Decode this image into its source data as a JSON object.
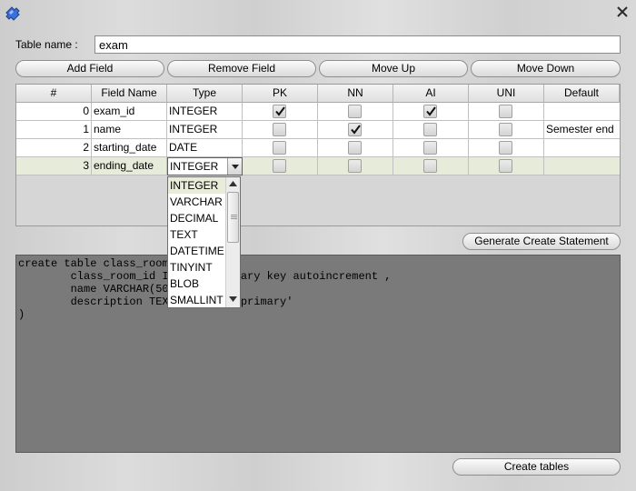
{
  "window": {
    "app_icon": "puzzle-app-icon",
    "close_icon": "close-icon"
  },
  "table_name": {
    "label": "Table name :",
    "value": "exam"
  },
  "toolbar": {
    "add_field": "Add Field",
    "remove_field": "Remove Field",
    "move_up": "Move Up",
    "move_down": "Move Down"
  },
  "grid": {
    "headers": [
      "#",
      "Field Name",
      "Type",
      "PK",
      "NN",
      "AI",
      "UNI",
      "Default"
    ],
    "rows": [
      {
        "index": "0",
        "name": "exam_id",
        "type": "INTEGER",
        "pk": true,
        "nn": false,
        "ai": true,
        "uni": false,
        "default": ""
      },
      {
        "index": "1",
        "name": "name",
        "type": "INTEGER",
        "pk": false,
        "nn": true,
        "ai": false,
        "uni": false,
        "default": "Semester end"
      },
      {
        "index": "2",
        "name": "starting_date",
        "type": "DATE",
        "pk": false,
        "nn": false,
        "ai": false,
        "uni": false,
        "default": ""
      },
      {
        "index": "3",
        "name": "ending_date",
        "type": "INTEGER",
        "pk": false,
        "nn": false,
        "ai": false,
        "uni": false,
        "default": ""
      }
    ],
    "selected_row": 3
  },
  "type_dropdown": {
    "options": [
      "INTEGER",
      "VARCHAR",
      "DECIMAL",
      "TEXT",
      "DATETIME",
      "TINYINT",
      "BLOB",
      "SMALLINT"
    ],
    "selected": "INTEGER"
  },
  "generate_button": "Generate Create Statement",
  "sql_output": "create table class_room(\n        class_room_id INTEGER primary key autoincrement ,\n        name VARCHAR(50) ,\n        description TEXT default 'primary'\n)",
  "create_button": "Create tables",
  "colors": {
    "selected_row": "#e7ebd9",
    "sql_background": "#7a7a7a"
  }
}
